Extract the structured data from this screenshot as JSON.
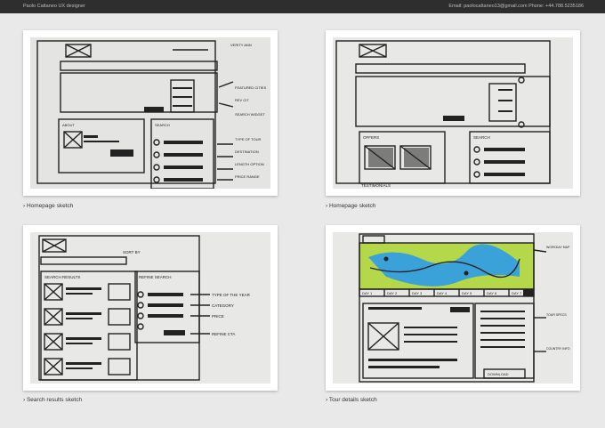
{
  "header": {
    "name": "Paolo Cattaneo UX designer",
    "contact": "Email: paolocattaneo13@gmail.com Phone: +44.788.5235186"
  },
  "cards": [
    {
      "caption": "› Homepage sketch",
      "sketch_labels": [
        "VERITY ANN",
        "FEATURED CITIES",
        "REV CIT",
        "SEARCH WIDGET",
        "TYPE OF TOUR",
        "DESTINATION",
        "LENGTH OPTION",
        "PRICE RANGE",
        "ABOUT",
        "SEARCH"
      ]
    },
    {
      "caption": "› Homepage sketch",
      "sketch_labels": [
        "OFFERS",
        "SEARCH",
        "TESTIMONIALS"
      ]
    },
    {
      "caption": "› Search results sketch",
      "sketch_labels": [
        "SEARCH RESULTS",
        "REFINE SEARCH",
        "SORT BY",
        "TYPE OF THE YEAR",
        "CATEGORY",
        "PRICE",
        "REFINE CTA"
      ]
    },
    {
      "caption": "› Tour details sketch",
      "sketch_labels": [
        "DAY 1",
        "DAY 2",
        "DAY 3",
        "DAY 4",
        "DAY 5",
        "DAY 6",
        "DAY 7",
        "WORKDAY MAP",
        "TOUR SPECS",
        "COUNTRY INFO",
        "DOWNLOAD"
      ]
    }
  ]
}
